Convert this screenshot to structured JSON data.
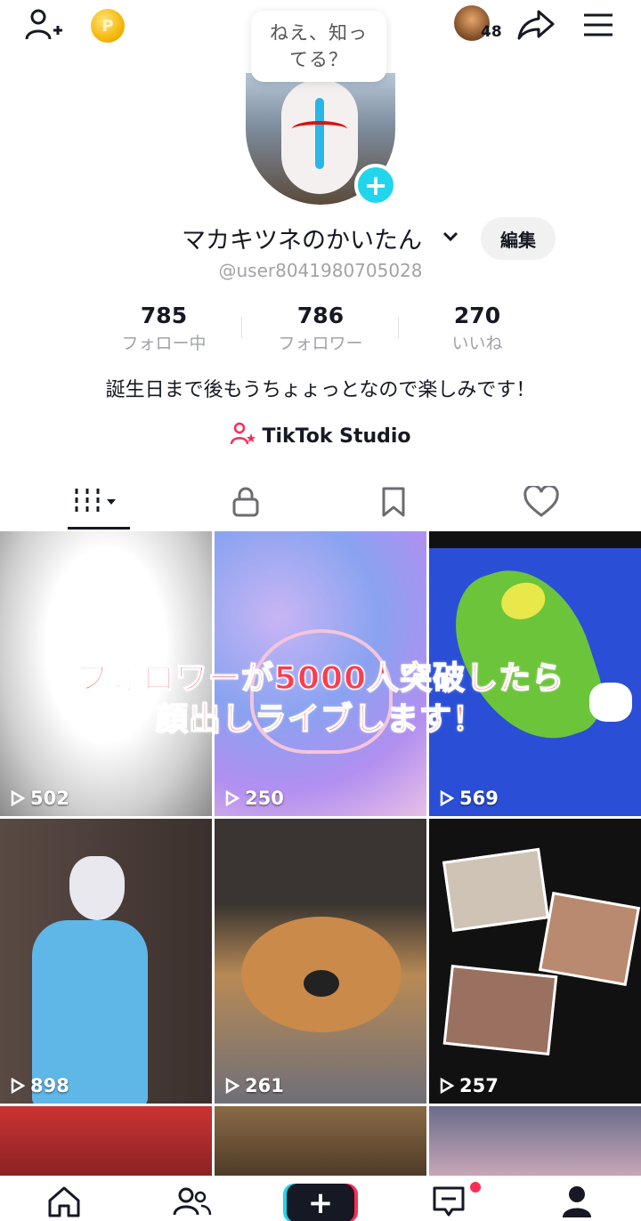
{
  "header": {
    "friends_count": "48",
    "coin_label": "P",
    "tooltip_line1": "ねえ、知っ",
    "tooltip_line2": "てる？"
  },
  "profile": {
    "name": "マカキツネのかいたん",
    "edit_label": "編集",
    "handle": "@user8041980705028",
    "bio": "誕生日まで後もうちょょっとなので楽しみです！",
    "studio_label": "TikTok Studio"
  },
  "stats": [
    {
      "value": "785",
      "label": "フォロー中"
    },
    {
      "value": "786",
      "label": "フォロワー"
    },
    {
      "value": "270",
      "label": "いいね"
    }
  ],
  "videos": [
    {
      "views": "502"
    },
    {
      "views": "250"
    },
    {
      "views": "569"
    },
    {
      "views": "898"
    },
    {
      "views": "261"
    },
    {
      "views": "257"
    }
  ],
  "banner": {
    "line1": "フォロワーが5000人突破したら",
    "line2": "顔出しライブします！"
  },
  "colors": {
    "accent_cyan": "#20d5ec",
    "accent_red": "#fe2c55",
    "banner_red": "#ff3b4e"
  }
}
